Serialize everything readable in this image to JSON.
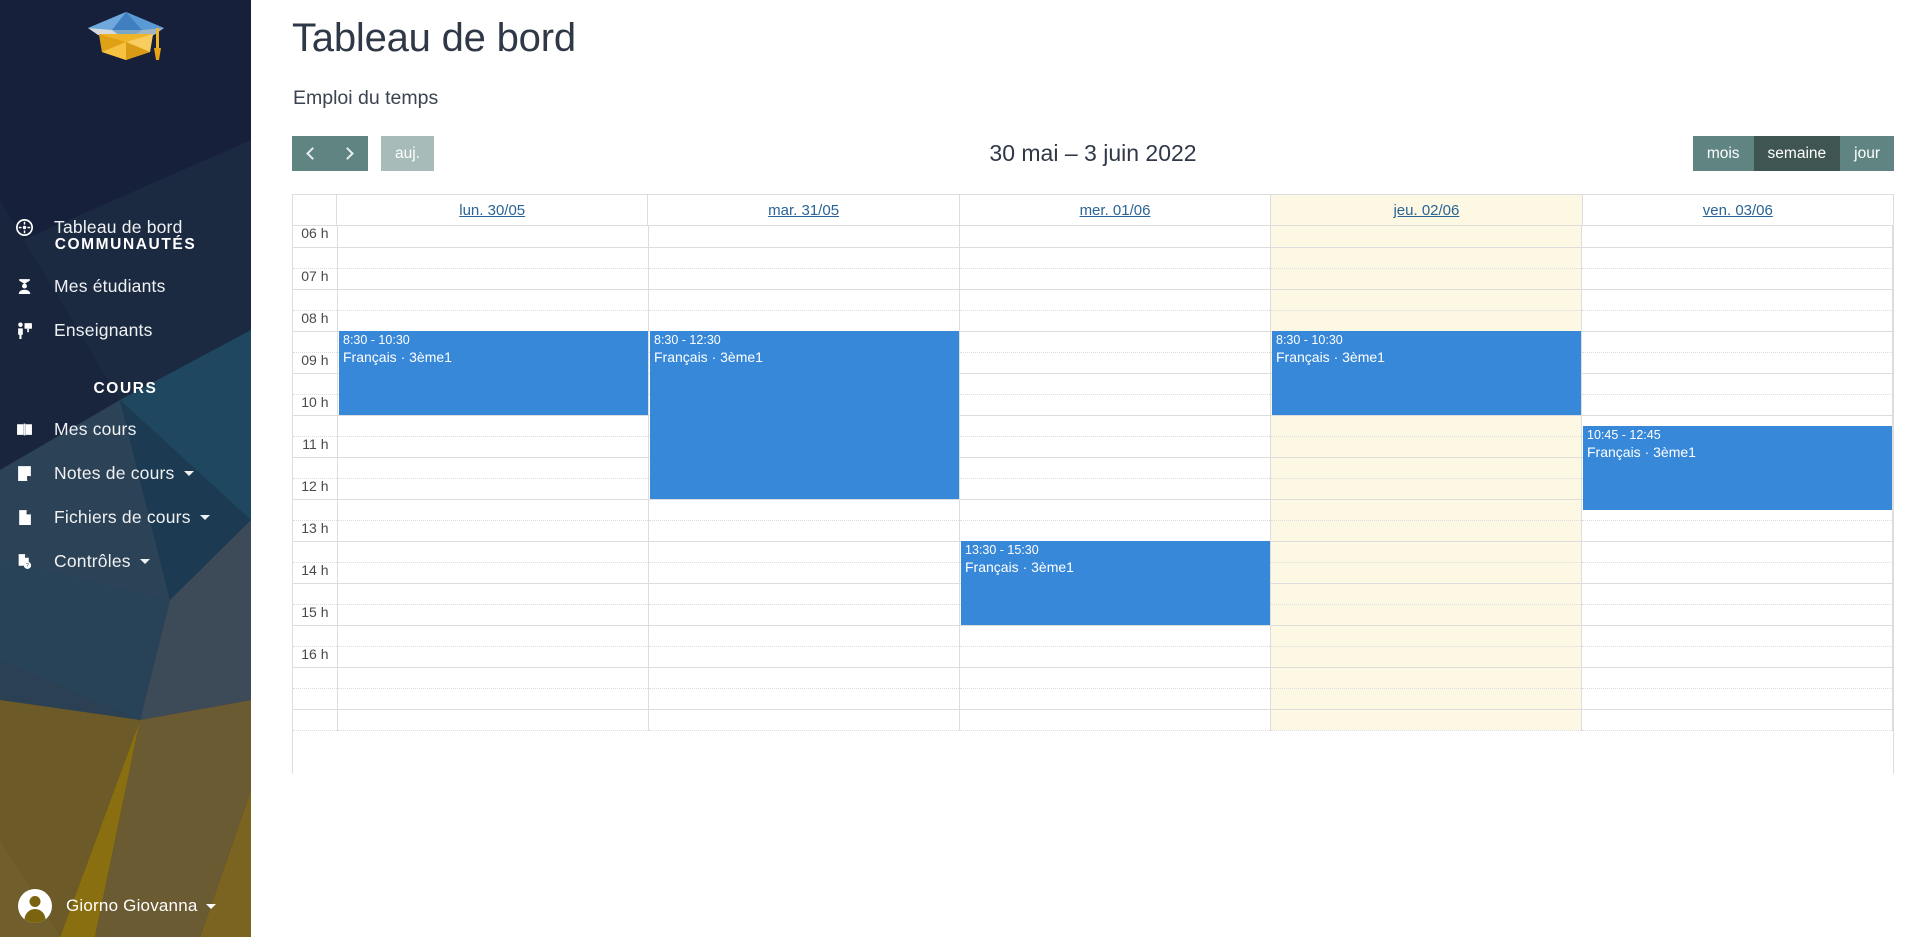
{
  "sidebar": {
    "logo_icon": "graduation-cap-icon",
    "dashboard": {
      "label": "Tableau de bord",
      "icon": "dashboard-gauge-icon"
    },
    "sections": [
      {
        "heading": "COMMUNAUTÉS",
        "items": [
          {
            "label": "Mes étudiants",
            "icon": "students-icon",
            "caret": false
          },
          {
            "label": "Enseignants",
            "icon": "teacher-presentation-icon",
            "caret": false
          }
        ]
      },
      {
        "heading": "COURS",
        "items": [
          {
            "label": "Mes cours",
            "icon": "open-book-icon",
            "caret": false
          },
          {
            "label": "Notes de cours",
            "icon": "note-page-icon",
            "caret": true
          },
          {
            "label": "Fichiers de cours",
            "icon": "file-icon",
            "caret": true
          },
          {
            "label": "Contrôles",
            "icon": "file-question-icon",
            "caret": true
          }
        ]
      }
    ],
    "user": {
      "name": "Giorno Giovanna",
      "avatar_icon": "user-avatar-icon",
      "caret": true
    }
  },
  "header": {
    "title": "Tableau de bord",
    "subtitle": "Emploi du temps"
  },
  "toolbar": {
    "prev_icon": "chevron-left-icon",
    "next_icon": "chevron-right-icon",
    "today_label": "auj.",
    "today_disabled": true,
    "title": "30 mai – 3 juin 2022",
    "views": [
      {
        "label": "mois",
        "active": false
      },
      {
        "label": "semaine",
        "active": true
      },
      {
        "label": "jour",
        "active": false
      }
    ]
  },
  "calendar": {
    "days": [
      {
        "label": "lun. 30/05",
        "today": false
      },
      {
        "label": "mar. 31/05",
        "today": false
      },
      {
        "label": "mer. 01/06",
        "today": false
      },
      {
        "label": "jeu. 02/06",
        "today": true
      },
      {
        "label": "ven. 03/06",
        "today": false
      }
    ],
    "time_labels": [
      "06 h",
      "07 h",
      "08 h",
      "09 h",
      "10 h",
      "11 h",
      "12 h",
      "13 h",
      "14 h",
      "15 h",
      "16 h",
      ""
    ],
    "slot_start_hour": 6,
    "slot_minutes": 30,
    "event_color": "#3788d8",
    "today_color": "#fcf8e3",
    "events": [
      {
        "day": 0,
        "time": "8:30 - 10:30",
        "title": "Français · 3ème1",
        "start_hour": 8.5,
        "end_hour": 10.5
      },
      {
        "day": 1,
        "time": "8:30 - 12:30",
        "title": "Français · 3ème1",
        "start_hour": 8.5,
        "end_hour": 12.5
      },
      {
        "day": 2,
        "time": "13:30 - 15:30",
        "title": "Français · 3ème1",
        "start_hour": 13.5,
        "end_hour": 15.5
      },
      {
        "day": 3,
        "time": "8:30 - 10:30",
        "title": "Français · 3ème1",
        "start_hour": 8.5,
        "end_hour": 10.5
      },
      {
        "day": 4,
        "time": "10:45 - 12:45",
        "title": "Français · 3ème1",
        "start_hour": 10.75,
        "end_hour": 12.75
      }
    ]
  }
}
